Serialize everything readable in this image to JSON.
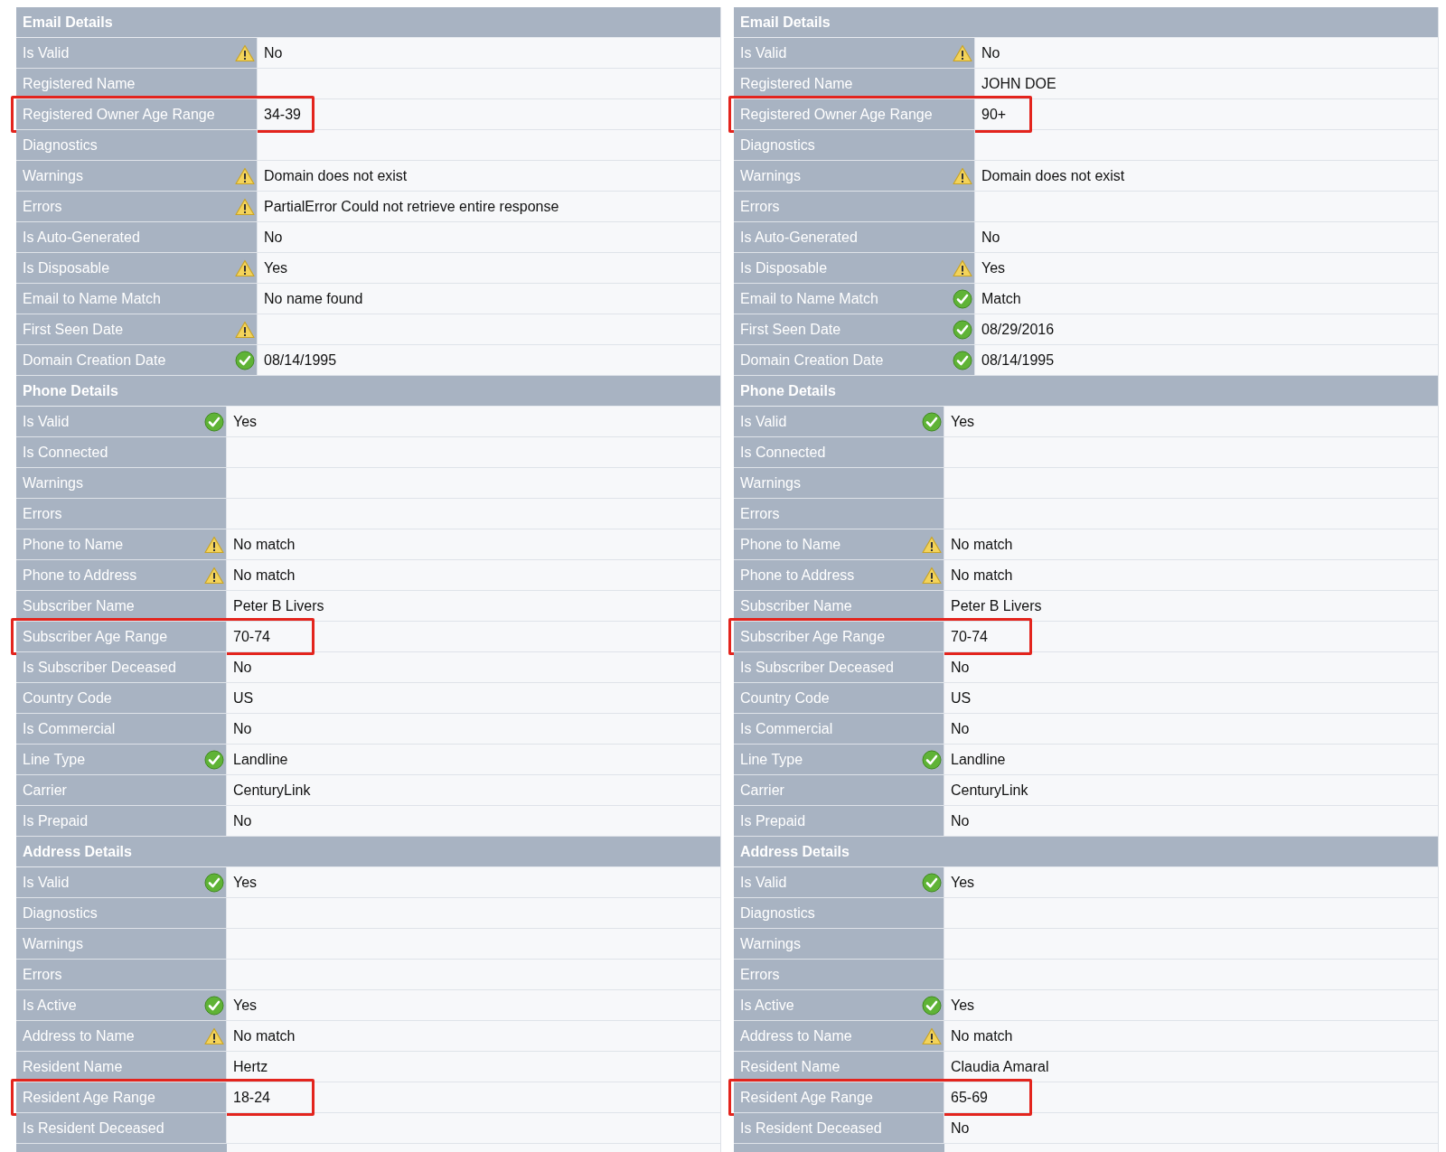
{
  "panels": [
    {
      "sections": [
        {
          "title": "Email Details",
          "rows": [
            {
              "label": "Is Valid",
              "kind": "warning",
              "value": "No",
              "highlighted": false
            },
            {
              "label": "Registered Name",
              "kind": "plain",
              "value": "",
              "highlighted": false
            },
            {
              "label": "Registered Owner Age Range",
              "kind": "plain",
              "value": "34-39",
              "highlighted": true
            },
            {
              "label": "Diagnostics",
              "kind": "plain",
              "value": "",
              "highlighted": false
            },
            {
              "label": "Warnings",
              "kind": "warning",
              "value": "Domain does not exist",
              "highlighted": false
            },
            {
              "label": "Errors",
              "kind": "warning",
              "value": "PartialError Could not retrieve entire response",
              "highlighted": false
            },
            {
              "label": "Is Auto-Generated",
              "kind": "plain",
              "value": "No",
              "highlighted": false
            },
            {
              "label": "Is Disposable",
              "kind": "warning",
              "value": "Yes",
              "highlighted": false
            },
            {
              "label": "Email to Name Match",
              "kind": "plain",
              "value": "No name found",
              "highlighted": false
            },
            {
              "label": "First Seen Date",
              "kind": "warning",
              "value": "",
              "highlighted": false
            },
            {
              "label": "Domain Creation Date",
              "kind": "ok",
              "value": "08/14/1995",
              "highlighted": false
            }
          ]
        },
        {
          "title": "Phone Details",
          "rows": [
            {
              "label": "Is Valid",
              "kind": "ok",
              "value": "Yes",
              "highlighted": false
            },
            {
              "label": "Is Connected",
              "kind": "plain",
              "value": "",
              "highlighted": false
            },
            {
              "label": "Warnings",
              "kind": "plain",
              "value": "",
              "highlighted": false
            },
            {
              "label": "Errors",
              "kind": "plain",
              "value": "",
              "highlighted": false
            },
            {
              "label": "Phone to Name",
              "kind": "warning",
              "value": "No match",
              "highlighted": false
            },
            {
              "label": "Phone to Address",
              "kind": "warning",
              "value": "No match",
              "highlighted": false
            },
            {
              "label": "Subscriber Name",
              "kind": "plain",
              "value": "Peter B Livers",
              "highlighted": false
            },
            {
              "label": "Subscriber Age Range",
              "kind": "plain",
              "value": "70-74",
              "highlighted": true
            },
            {
              "label": "Is Subscriber Deceased",
              "kind": "plain",
              "value": "No",
              "highlighted": false
            },
            {
              "label": "Country Code",
              "kind": "plain",
              "value": "US",
              "highlighted": false
            },
            {
              "label": "Is Commercial",
              "kind": "plain",
              "value": "No",
              "highlighted": false
            },
            {
              "label": "Line Type",
              "kind": "ok",
              "value": "Landline",
              "highlighted": false
            },
            {
              "label": "Carrier",
              "kind": "plain",
              "value": "CenturyLink",
              "highlighted": false
            },
            {
              "label": "Is Prepaid",
              "kind": "plain",
              "value": "No",
              "highlighted": false
            }
          ]
        },
        {
          "title": "Address Details",
          "rows": [
            {
              "label": "Is Valid",
              "kind": "ok",
              "value": "Yes",
              "highlighted": false
            },
            {
              "label": "Diagnostics",
              "kind": "plain",
              "value": "",
              "highlighted": false
            },
            {
              "label": "Warnings",
              "kind": "plain",
              "value": "",
              "highlighted": false
            },
            {
              "label": "Errors",
              "kind": "plain",
              "value": "",
              "highlighted": false
            },
            {
              "label": "Is Active",
              "kind": "ok",
              "value": "Yes",
              "highlighted": false
            },
            {
              "label": "Address to Name",
              "kind": "warning",
              "value": "No match",
              "highlighted": false
            },
            {
              "label": "Resident Name",
              "kind": "plain",
              "value": "Hertz",
              "highlighted": false
            },
            {
              "label": "Resident Age Range",
              "kind": "plain",
              "value": "18-24",
              "highlighted": true
            },
            {
              "label": "Is Resident Deceased",
              "kind": "plain",
              "value": "",
              "highlighted": false
            }
          ]
        }
      ]
    },
    {
      "sections": [
        {
          "title": "Email Details",
          "rows": [
            {
              "label": "Is Valid",
              "kind": "warning",
              "value": "No",
              "highlighted": false
            },
            {
              "label": "Registered Name",
              "kind": "plain",
              "value": "JOHN DOE",
              "highlighted": false
            },
            {
              "label": "Registered Owner Age Range",
              "kind": "plain",
              "value": "90+",
              "highlighted": true
            },
            {
              "label": "Diagnostics",
              "kind": "plain",
              "value": "",
              "highlighted": false
            },
            {
              "label": "Warnings",
              "kind": "warning",
              "value": "Domain does not exist",
              "highlighted": false
            },
            {
              "label": "Errors",
              "kind": "plain",
              "value": "",
              "highlighted": false
            },
            {
              "label": "Is Auto-Generated",
              "kind": "plain",
              "value": "No",
              "highlighted": false
            },
            {
              "label": "Is Disposable",
              "kind": "warning",
              "value": "Yes",
              "highlighted": false
            },
            {
              "label": "Email to Name Match",
              "kind": "ok",
              "value": "Match",
              "highlighted": false
            },
            {
              "label": "First Seen Date",
              "kind": "ok",
              "value": "08/29/2016",
              "highlighted": false
            },
            {
              "label": "Domain Creation Date",
              "kind": "ok",
              "value": "08/14/1995",
              "highlighted": false
            }
          ]
        },
        {
          "title": "Phone Details",
          "rows": [
            {
              "label": "Is Valid",
              "kind": "ok",
              "value": "Yes",
              "highlighted": false
            },
            {
              "label": "Is Connected",
              "kind": "plain",
              "value": "",
              "highlighted": false
            },
            {
              "label": "Warnings",
              "kind": "plain",
              "value": "",
              "highlighted": false
            },
            {
              "label": "Errors",
              "kind": "plain",
              "value": "",
              "highlighted": false
            },
            {
              "label": "Phone to Name",
              "kind": "warning",
              "value": "No match",
              "highlighted": false
            },
            {
              "label": "Phone to Address",
              "kind": "warning",
              "value": "No match",
              "highlighted": false
            },
            {
              "label": "Subscriber Name",
              "kind": "plain",
              "value": "Peter B Livers",
              "highlighted": false
            },
            {
              "label": "Subscriber Age Range",
              "kind": "plain",
              "value": "70-74",
              "highlighted": true
            },
            {
              "label": "Is Subscriber Deceased",
              "kind": "plain",
              "value": "No",
              "highlighted": false
            },
            {
              "label": "Country Code",
              "kind": "plain",
              "value": "US",
              "highlighted": false
            },
            {
              "label": "Is Commercial",
              "kind": "plain",
              "value": "No",
              "highlighted": false
            },
            {
              "label": "Line Type",
              "kind": "ok",
              "value": "Landline",
              "highlighted": false
            },
            {
              "label": "Carrier",
              "kind": "plain",
              "value": "CenturyLink",
              "highlighted": false
            },
            {
              "label": "Is Prepaid",
              "kind": "plain",
              "value": "No",
              "highlighted": false
            }
          ]
        },
        {
          "title": "Address Details",
          "rows": [
            {
              "label": "Is Valid",
              "kind": "ok",
              "value": "Yes",
              "highlighted": false
            },
            {
              "label": "Diagnostics",
              "kind": "plain",
              "value": "",
              "highlighted": false
            },
            {
              "label": "Warnings",
              "kind": "plain",
              "value": "",
              "highlighted": false
            },
            {
              "label": "Errors",
              "kind": "plain",
              "value": "",
              "highlighted": false
            },
            {
              "label": "Is Active",
              "kind": "ok",
              "value": "Yes",
              "highlighted": false
            },
            {
              "label": "Address to Name",
              "kind": "warning",
              "value": "No match",
              "highlighted": false
            },
            {
              "label": "Resident Name",
              "kind": "plain",
              "value": "Claudia Amaral",
              "highlighted": false
            },
            {
              "label": "Resident Age Range",
              "kind": "plain",
              "value": "65-69",
              "highlighted": true
            },
            {
              "label": "Is Resident Deceased",
              "kind": "plain",
              "value": "No",
              "highlighted": false
            }
          ]
        }
      ]
    }
  ]
}
